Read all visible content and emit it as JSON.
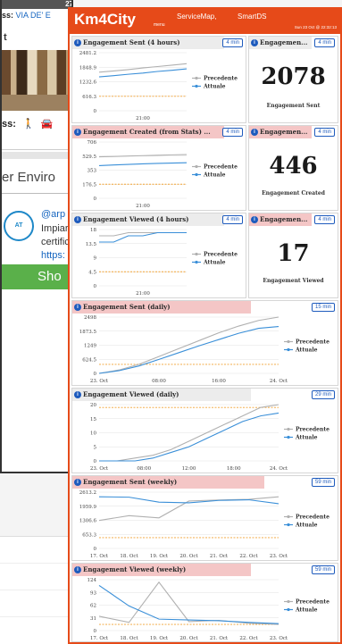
{
  "background_app": {
    "status_time": "27",
    "address_prefix": "ss:",
    "address_link": "VIA DE' E",
    "close_glyph": "t",
    "access_label": "ss:",
    "walk_glyph": "🚶",
    "car_glyph": "🚘",
    "env_text": "er Enviro",
    "logo_text": "AT",
    "handle": "@arp",
    "line1": "Impiar",
    "line2": "certific",
    "link": "https:",
    "show_label": "Sho"
  },
  "header": {
    "brand": "Km4City",
    "brand_sub": "menu",
    "nav_items": [
      "ServiceMap,",
      "SmartDS"
    ],
    "datetime": "Sun 23 Oct @ 22:32:13",
    "color": "#e64a19"
  },
  "widgets": {
    "sent4h": {
      "title": "Engagement Sent (4 hours)",
      "badge": "4 min",
      "chart_data": {
        "type": "line",
        "yticks": [
          "2481.2",
          "1848.9",
          "1232.6",
          "616.3",
          "0"
        ],
        "xticks": [
          "21:00"
        ],
        "ylim": [
          0,
          2481.2
        ],
        "series": [
          {
            "name": "Precedente",
            "color": "#b0b0b0",
            "values": [
              1650,
              1700,
              1760,
              1830,
              1890,
              1950,
              2010
            ]
          },
          {
            "name": "Attuale",
            "color": "#3a8fd8",
            "values": [
              1450,
              1500,
              1560,
              1610,
              1680,
              1730,
              1790
            ]
          }
        ],
        "threshold": 616.3
      }
    },
    "sent_stat": {
      "title": "Engagemen...",
      "badge": "4 min",
      "value": "2078",
      "label": "Engagement Sent"
    },
    "created": {
      "title": "Engagement Created (from Stats) ...",
      "badge": "4 min",
      "chart_data": {
        "type": "line",
        "yticks": [
          "706",
          "529.5",
          "353",
          "176.5",
          "0"
        ],
        "xticks": [
          "21:00"
        ],
        "ylim": [
          0,
          706
        ],
        "series": [
          {
            "name": "Precedente",
            "color": "#b0b0b0",
            "values": [
              520,
              525,
              530,
              535,
              540,
              545,
              548
            ]
          },
          {
            "name": "Attuale",
            "color": "#3a8fd8",
            "values": [
              410,
              418,
              425,
              432,
              438,
              442,
              446
            ]
          }
        ],
        "threshold": 176.5
      }
    },
    "created_stat": {
      "title": "Engagemen...",
      "badge": "4 min",
      "value": "446",
      "label": "Engagement Created"
    },
    "viewed4h": {
      "title": "Engagement Viewed (4 hours)",
      "badge": "4 min",
      "chart_data": {
        "type": "line",
        "yticks": [
          "18",
          "13.5",
          "9",
          "4.5",
          "0"
        ],
        "xticks": [
          "21:00"
        ],
        "ylim": [
          0,
          18
        ],
        "series": [
          {
            "name": "Precedente",
            "color": "#b0b0b0",
            "values": [
              16,
              16,
              17,
              17,
              17,
              17,
              17
            ]
          },
          {
            "name": "Attuale",
            "color": "#3a8fd8",
            "values": [
              14,
              14,
              16,
              16,
              17,
              17,
              17
            ]
          }
        ],
        "threshold": 4.5
      }
    },
    "viewed_stat": {
      "title": "Engagemen...",
      "badge": "4 min",
      "value": "17",
      "label": "Engagement Viewed"
    },
    "sent_daily": {
      "title": "Engagement Sent (daily)",
      "badge": "15 min",
      "chart_data": {
        "type": "line",
        "yticks": [
          "2498",
          "1873.5",
          "1249",
          "624.5",
          "0"
        ],
        "xticks": [
          "23. Oct",
          "08:00",
          "16:00",
          "24. Oct"
        ],
        "ylim": [
          0,
          2498
        ],
        "series": [
          {
            "name": "Precedente",
            "color": "#b0b0b0",
            "values": [
              0,
              150,
              400,
              750,
              1100,
              1450,
              1800,
              2100,
              2350,
              2498
            ]
          },
          {
            "name": "Attuale",
            "color": "#3a8fd8",
            "values": [
              0,
              120,
              330,
              620,
              920,
              1220,
              1500,
              1780,
              2000,
              2078
            ]
          }
        ],
        "threshold": 400
      }
    },
    "viewed_daily": {
      "title": "Engagement Viewed (daily)",
      "badge": "29 min",
      "chart_data": {
        "type": "line",
        "yticks": [
          "20",
          "15",
          "10",
          "5",
          "0"
        ],
        "xticks": [
          "23. Oct",
          "08:00",
          "12:00",
          "18:00",
          "24. Oct"
        ],
        "ylim": [
          0,
          20
        ],
        "series": [
          {
            "name": "Precedente",
            "color": "#b0b0b0",
            "values": [
              0,
              0,
              1,
              2,
              4,
              7,
              10,
              13,
              16,
              19,
              20
            ]
          },
          {
            "name": "Attuale",
            "color": "#3a8fd8",
            "values": [
              0,
              0,
              0,
              1,
              3,
              5,
              8,
              11,
              14,
              16,
              17
            ]
          }
        ],
        "threshold": 19
      }
    },
    "sent_weekly": {
      "title": "Engagement Sent (weekly)",
      "badge": "59 min",
      "chart_data": {
        "type": "line",
        "yticks": [
          "2613.2",
          "1959.9",
          "1306.6",
          "653.3",
          "0"
        ],
        "xticks": [
          "17. Oct",
          "18. Oct",
          "19. Oct",
          "20. Oct",
          "21. Oct",
          "22. Oct",
          "23. Oct"
        ],
        "ylim": [
          0,
          2613.2
        ],
        "series": [
          {
            "name": "Precedente",
            "color": "#b0b0b0",
            "values": [
              1300,
              1520,
              1420,
              2200,
              2250,
              2280,
              2400
            ]
          },
          {
            "name": "Attuale",
            "color": "#3a8fd8",
            "values": [
              2400,
              2380,
              2150,
              2120,
              2230,
              2260,
              2078
            ]
          }
        ],
        "threshold": 500
      }
    },
    "viewed_weekly": {
      "title": "Engagement Viewed (weekly)",
      "badge": "59 min",
      "chart_data": {
        "type": "line",
        "yticks": [
          "124",
          "93",
          "62",
          "31",
          "0"
        ],
        "xticks": [
          "17. Oct",
          "18. Oct",
          "19. Oct",
          "20. Oct",
          "21. Oct",
          "22. Oct",
          "23. Oct"
        ],
        "ylim": [
          0,
          124
        ],
        "series": [
          {
            "name": "Precedente",
            "color": "#b0b0b0",
            "values": [
              35,
              20,
              118,
              22,
              25,
              18,
              15
            ]
          },
          {
            "name": "Attuale",
            "color": "#3a8fd8",
            "values": [
              110,
              60,
              28,
              26,
              24,
              20,
              17
            ]
          }
        ],
        "threshold": 15
      }
    }
  },
  "legend_labels": {
    "prev": "Precedente",
    "curr": "Attuale"
  }
}
